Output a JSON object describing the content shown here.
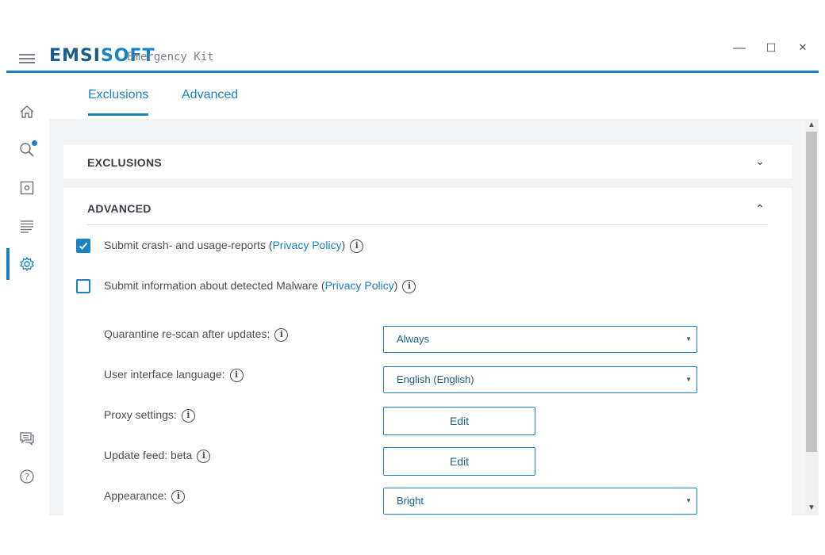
{
  "app": {
    "brand_emsi": "EMSI",
    "brand_soft": "SOFT",
    "product": "Emergency Kit"
  },
  "window_controls": {
    "minimize": "—",
    "maximize": "☐",
    "close": "✕"
  },
  "sidebar": {
    "items": [
      {
        "icon": "home-icon"
      },
      {
        "icon": "scan-icon",
        "badge": true
      },
      {
        "icon": "quarantine-icon"
      },
      {
        "icon": "logs-icon"
      },
      {
        "icon": "settings-icon",
        "active": true
      },
      {
        "icon": "feedback-icon"
      },
      {
        "icon": "help-icon"
      }
    ]
  },
  "tabs": [
    {
      "label": "Exclusions",
      "active": true
    },
    {
      "label": "Advanced",
      "active": false
    }
  ],
  "sections": {
    "exclusions": {
      "title": "EXCLUSIONS",
      "expanded": false
    },
    "advanced": {
      "title": "ADVANCED",
      "expanded": true
    }
  },
  "options": {
    "crash_reports": {
      "checked": true,
      "text": "Submit crash- and usage-reports (",
      "link": "Privacy Policy",
      "tail": ")"
    },
    "malware_info": {
      "checked": false,
      "text": "Submit information about detected Malware (",
      "link": "Privacy Policy",
      "tail": ")"
    }
  },
  "settings": {
    "quarantine": {
      "label": "Quarantine re-scan after updates:",
      "value": "Always"
    },
    "language": {
      "label": "User interface language:",
      "value": "English (English)"
    },
    "proxy": {
      "label": "Proxy settings:",
      "button": "Edit"
    },
    "update_feed": {
      "label": "Update feed: beta",
      "button": "Edit"
    },
    "appearance": {
      "label": "Appearance:",
      "value": "Bright"
    }
  },
  "colors": {
    "accent": "#1a82c4",
    "brand_dark": "#1a5e8c",
    "text": "#4a4f55",
    "background": "#f2f3f4"
  }
}
